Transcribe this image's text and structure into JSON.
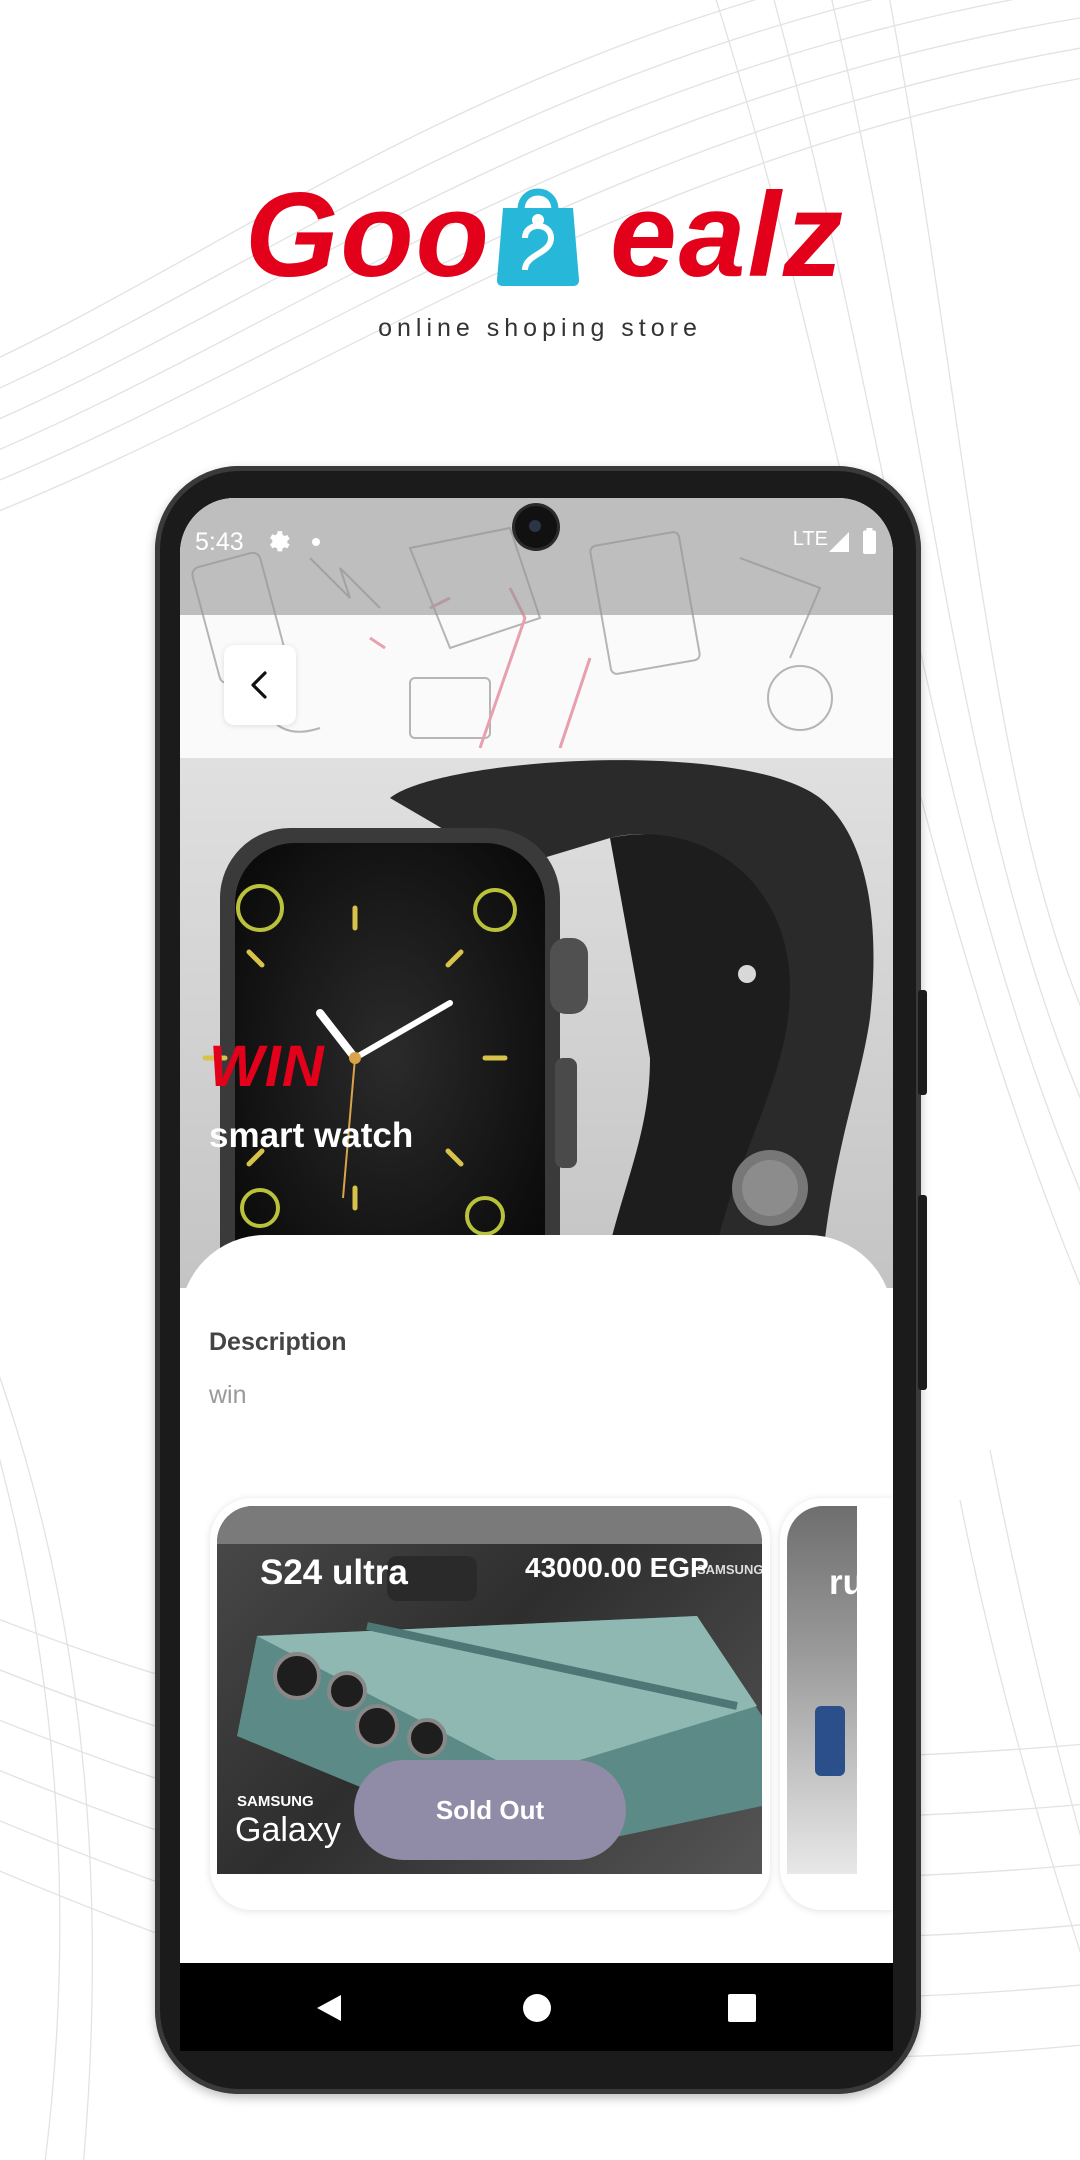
{
  "brand": {
    "name_left": "Goo",
    "name_right": "ealz",
    "tagline": "online shoping store"
  },
  "status_bar": {
    "time": "5:43",
    "network": "LTE"
  },
  "product": {
    "badge": "WIN",
    "title": "smart watch",
    "description_label": "Description",
    "description": "win"
  },
  "cards": [
    {
      "name": "S24 ultra",
      "price": "43000.00 EGP",
      "button": "Sold Out",
      "image_text_brand": "SAMSUNG",
      "image_text_model": "Galaxy"
    },
    {
      "name": "ru sh"
    }
  ],
  "colors": {
    "brand_red": "#e3001b",
    "bag_blue": "#27b7d8",
    "sold_out_button": "#908ba6"
  },
  "icons": [
    "back-chevron-icon",
    "settings-gear-icon",
    "signal-icon",
    "battery-icon",
    "nav-back-icon",
    "nav-home-icon",
    "nav-recents-icon"
  ]
}
